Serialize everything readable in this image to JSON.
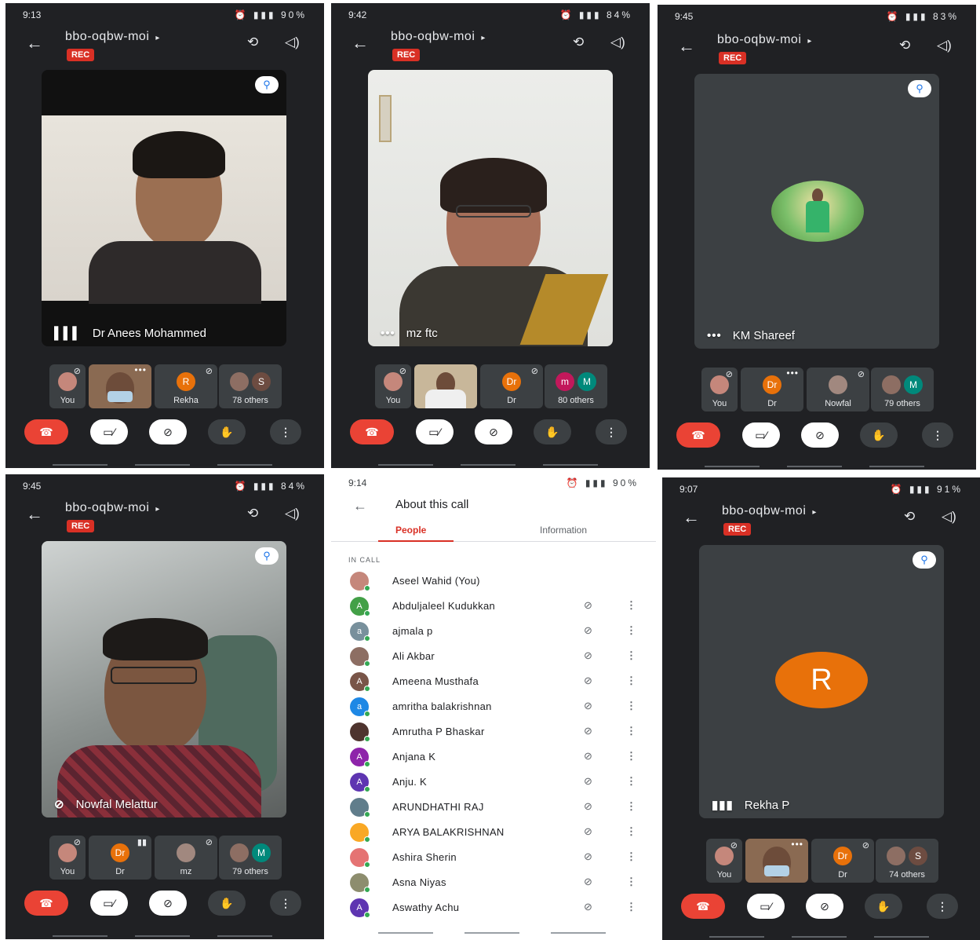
{
  "meeting": {
    "code": "bbo-oqbw-moi",
    "rec_label": "REC",
    "menu_arrow": "▸"
  },
  "icons": {
    "back": "arrow-back-icon",
    "camera_switch": "camera-switch-icon",
    "speaker": "speaker-icon",
    "pin": "pin-icon",
    "hangup": "hang-up-icon",
    "camera_off": "camera-off-icon",
    "mic_off": "mic-off-icon",
    "raise_hand": "raise-hand-icon",
    "more": "more-vert-icon"
  },
  "colors": {
    "hangup": "#ea4335",
    "rec": "#d93025",
    "accent_orange": "#e8710a",
    "online_dot": "#34a853"
  },
  "screens": {
    "s1": {
      "time": "9:13",
      "battery": "90%",
      "speaker_name": "Dr Anees Mohammed",
      "speaker_indicator": "▌▌▌",
      "thumbs": {
        "you": "You",
        "rekha_initial": "R",
        "rekha": "Rekha",
        "others_initial": "S",
        "others": "78 others"
      }
    },
    "s2": {
      "time": "9:42",
      "battery": "84%",
      "speaker_name": "mz ftc",
      "speaker_indicator": "•••",
      "thumbs": {
        "you": "You",
        "dr_initial": "Dr",
        "dr": "Dr",
        "others_initial1": "m",
        "others_initial2": "M",
        "others": "80 others"
      }
    },
    "s3": {
      "time": "9:45",
      "battery": "83%",
      "speaker_name": "KM Shareef",
      "speaker_indicator": "•••",
      "thumbs": {
        "you": "You",
        "dr_initial": "Dr",
        "dr": "Dr",
        "nowfal": "Nowfal",
        "others_initial": "M",
        "others": "79 others"
      }
    },
    "s4": {
      "time": "9:45",
      "battery": "84%",
      "speaker_name": "Nowfal Melattur",
      "thumbs": {
        "you": "You",
        "dr_initial": "Dr",
        "dr": "Dr",
        "mz": "mz",
        "others_initial": "M",
        "others": "79 others"
      }
    },
    "s5": {
      "time": "9:14",
      "battery": "90%",
      "title": "About this call",
      "tabs": [
        "People",
        "Information"
      ],
      "section": "IN CALL",
      "people": [
        {
          "name": "Aseel Wahid (You)",
          "initial": "",
          "color": "#c5877b",
          "muted": false
        },
        {
          "name": "Abduljaleel Kudukkan",
          "initial": "A",
          "color": "#43a047",
          "muted": true
        },
        {
          "name": "ajmala p",
          "initial": "a",
          "color": "#78909c",
          "muted": true
        },
        {
          "name": "Ali Akbar",
          "initial": "",
          "color": "#8d6e63",
          "muted": true
        },
        {
          "name": "Ameena Musthafa",
          "initial": "A",
          "color": "#795548",
          "muted": true
        },
        {
          "name": "amritha balakrishnan",
          "initial": "a",
          "color": "#1e88e5",
          "muted": true
        },
        {
          "name": "Amrutha P Bhaskar",
          "initial": "",
          "color": "#4e342e",
          "muted": true
        },
        {
          "name": "Anjana K",
          "initial": "A",
          "color": "#8e24aa",
          "muted": true
        },
        {
          "name": "Anju. K",
          "initial": "A",
          "color": "#5e35b1",
          "muted": true
        },
        {
          "name": "ARUNDHATHI RAJ",
          "initial": "",
          "color": "#607d8b",
          "muted": true
        },
        {
          "name": "ARYA BALAKRISHNAN",
          "initial": "",
          "color": "#f9a825",
          "muted": true
        },
        {
          "name": "Ashira Sherin",
          "initial": "",
          "color": "#e57373",
          "muted": true
        },
        {
          "name": "Asna Niyas",
          "initial": "",
          "color": "#8d8d6e",
          "muted": true
        },
        {
          "name": "Aswathy Achu",
          "initial": "A",
          "color": "#5e35b1",
          "muted": true
        }
      ]
    },
    "s6": {
      "time": "9:07",
      "battery": "91%",
      "speaker_initial": "R",
      "speaker_name": "Rekha P",
      "speaker_indicator": "▮▮▮",
      "thumbs": {
        "you": "You",
        "dr_initial": "Dr",
        "dr": "Dr",
        "others_initial": "S",
        "others": "74 others"
      }
    }
  }
}
